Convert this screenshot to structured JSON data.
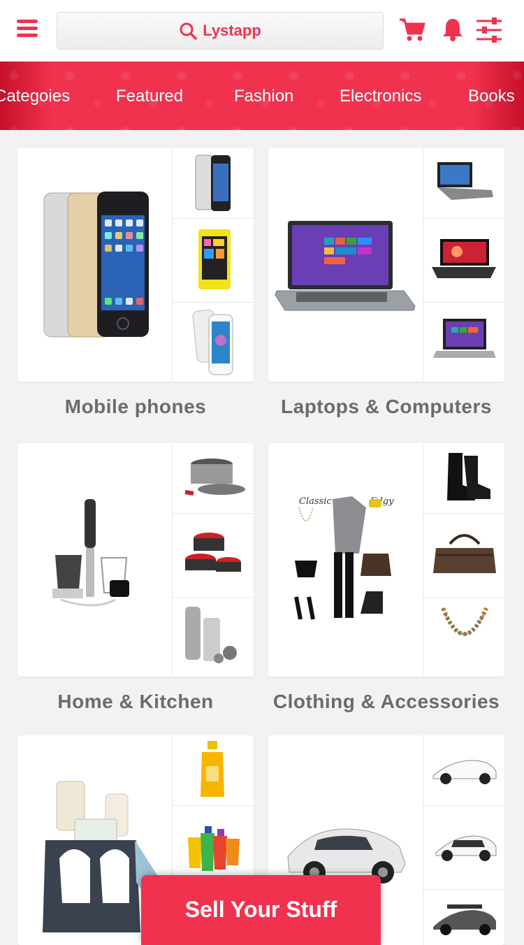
{
  "header": {
    "search_text": "Lystapp",
    "icons": [
      "menu-icon",
      "search-icon",
      "cart-icon",
      "bell-icon",
      "filter-sliders-icon"
    ],
    "accent_color": "#f0324f"
  },
  "tabs": [
    "Categoies",
    "Featured",
    "Fashion",
    "Electronics",
    "Books"
  ],
  "categories": [
    {
      "label": "Mobile phones"
    },
    {
      "label": "Laptops & Computers"
    },
    {
      "label": "Home & Kitchen"
    },
    {
      "label": "Clothing & Accessories"
    },
    {
      "label": ""
    },
    {
      "label": ""
    }
  ],
  "outfit_labels": {
    "left": "Classic",
    "right": "Edgy"
  },
  "sell_button": "Sell Your Stuff"
}
